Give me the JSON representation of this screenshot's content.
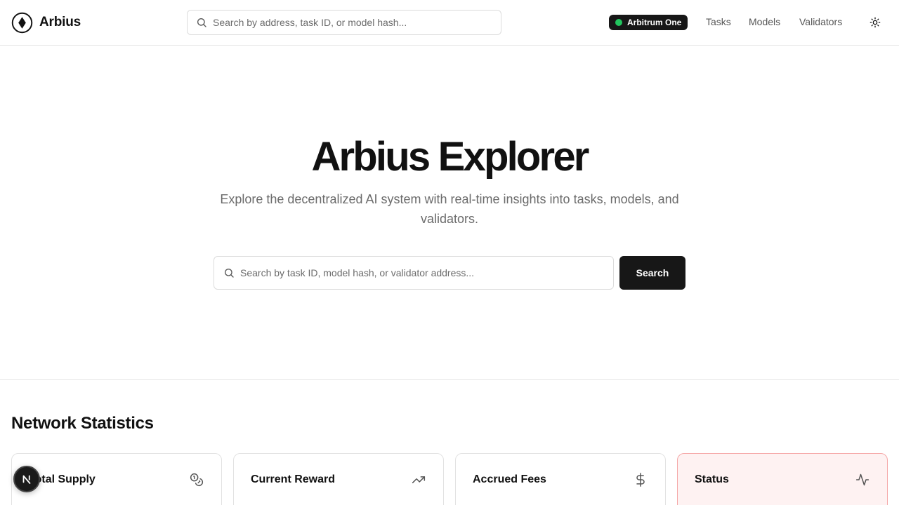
{
  "brand": {
    "name": "Arbius",
    "logo": "arbius-diamond-logo"
  },
  "header": {
    "search_placeholder": "Search by address, task ID, or model hash...",
    "network": {
      "label": "Arbitrum One",
      "status_color": "#22c55e"
    },
    "nav": [
      {
        "label": "Tasks"
      },
      {
        "label": "Models"
      },
      {
        "label": "Validators"
      }
    ],
    "theme_icon": "sun-icon"
  },
  "hero": {
    "title": "Arbius Explorer",
    "subtitle": "Explore the decentralized AI system with real-time insights into tasks, models, and validators.",
    "search_placeholder": "Search by task ID, model hash, or validator address...",
    "search_button": "Search"
  },
  "stats": {
    "title": "Network Statistics",
    "cards": [
      {
        "label": "Total Supply",
        "icon": "coins-icon"
      },
      {
        "label": "Current Reward",
        "icon": "trending-up-icon"
      },
      {
        "label": "Accrued Fees",
        "icon": "dollar-sign-icon"
      },
      {
        "label": "Status",
        "icon": "activity-icon",
        "accent": "#fef2f2"
      }
    ]
  },
  "colors": {
    "primary": "#171717",
    "muted_text": "#6b6b6b",
    "border": "#e5e5e5"
  }
}
